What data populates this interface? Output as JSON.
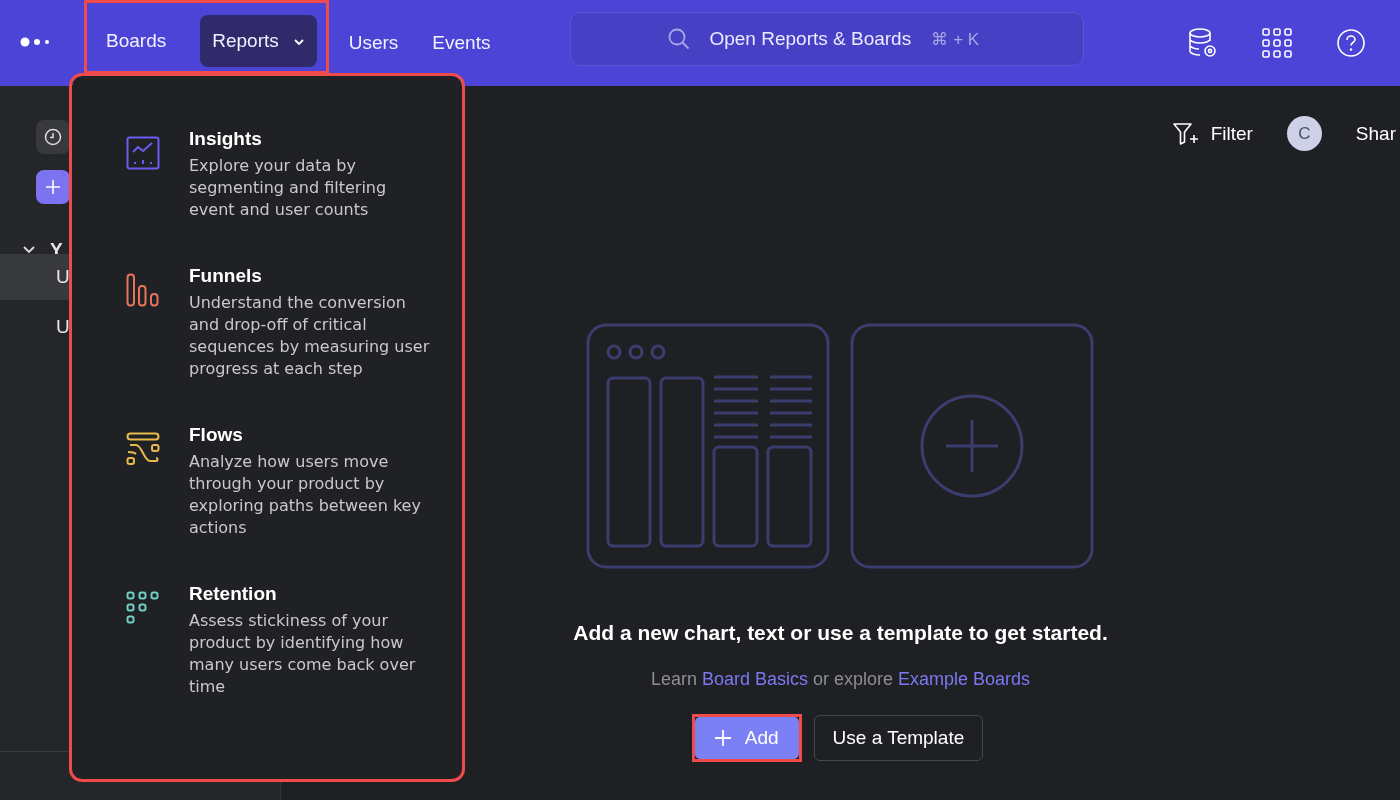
{
  "header": {
    "nav_highlighted": true,
    "nav": [
      {
        "label": "Boards",
        "kind": "link",
        "selected": false
      },
      {
        "label": "Reports",
        "kind": "dropdown",
        "selected": true
      },
      {
        "label": "Users",
        "kind": "link",
        "selected": false
      },
      {
        "label": "Events",
        "kind": "link",
        "selected": false
      }
    ],
    "search": {
      "placeholder": "Open Reports & Boards",
      "shortcut": "⌘ + K"
    }
  },
  "sidebar": {
    "section": {
      "label": "Y",
      "expanded": true
    },
    "items": [
      {
        "label": "U",
        "selected": true
      },
      {
        "label": "U",
        "selected": false
      }
    ]
  },
  "reports_menu": {
    "highlighted": true,
    "items": [
      {
        "kind": "insights",
        "color": "#6a5cf0",
        "title": "Insights",
        "description": "Explore your data by segmenting and filtering event and user counts"
      },
      {
        "kind": "funnels",
        "color": "#e8735a",
        "title": "Funnels",
        "description": "Understand the conversion and drop-off of critical sequences by measuring user progress at each step"
      },
      {
        "kind": "flows",
        "color": "#e9b949",
        "title": "Flows",
        "description": "Analyze how users move through your product by exploring paths between key actions"
      },
      {
        "kind": "retention",
        "color": "#6fcfc4",
        "title": "Retention",
        "description": "Assess stickiness of your product by identifying how many users come back over time"
      }
    ]
  },
  "toolbar": {
    "filter": "Filter",
    "avatar": "C",
    "share": "Shar"
  },
  "empty_state": {
    "heading": "Add a new chart, text or use a template to get started.",
    "hint": [
      {
        "text": "Learn ",
        "kind": "text"
      },
      {
        "text": "Board Basics",
        "kind": "link"
      },
      {
        "text": " or explore ",
        "kind": "text"
      },
      {
        "text": "Example Boards",
        "kind": "link"
      }
    ],
    "add_button": {
      "label": "Add",
      "highlighted": true
    },
    "template_button": "Use a Template"
  }
}
